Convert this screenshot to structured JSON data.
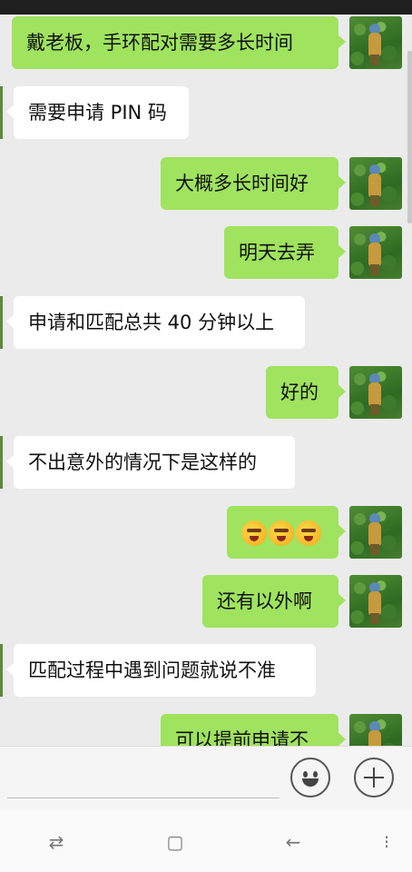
{
  "messages": [
    {
      "side": "out",
      "text": "戴老板，手环配对需要多长时间"
    },
    {
      "side": "in",
      "text": "需要申请 PIN 码"
    },
    {
      "side": "out",
      "text": "大概多长时间好"
    },
    {
      "side": "out",
      "text": "明天去弄"
    },
    {
      "side": "in",
      "text": "申请和匹配总共 40 分钟以上"
    },
    {
      "side": "out",
      "text": "好的"
    },
    {
      "side": "in",
      "text": "不出意外的情况下是这样的"
    },
    {
      "side": "out",
      "emoji": [
        "facepalm-emoji",
        "facepalm-emoji",
        "facepalm-emoji"
      ]
    },
    {
      "side": "out",
      "text": "还有以外啊"
    },
    {
      "side": "in",
      "text": "匹配过程中遇到问题就说不准"
    },
    {
      "side": "out",
      "text": "可以提前申请不"
    }
  ],
  "input_bar": {
    "emoji_icon": "smiley-icon",
    "more_icon": "plus-icon"
  },
  "nav_bar": {
    "icons": [
      "switch-icon",
      "square-icon",
      "back-icon",
      "menu-icon"
    ]
  },
  "colors": {
    "outgoing_bubble": "#9fe35f",
    "incoming_bubble": "#ffffff",
    "background": "#ebebeb"
  }
}
